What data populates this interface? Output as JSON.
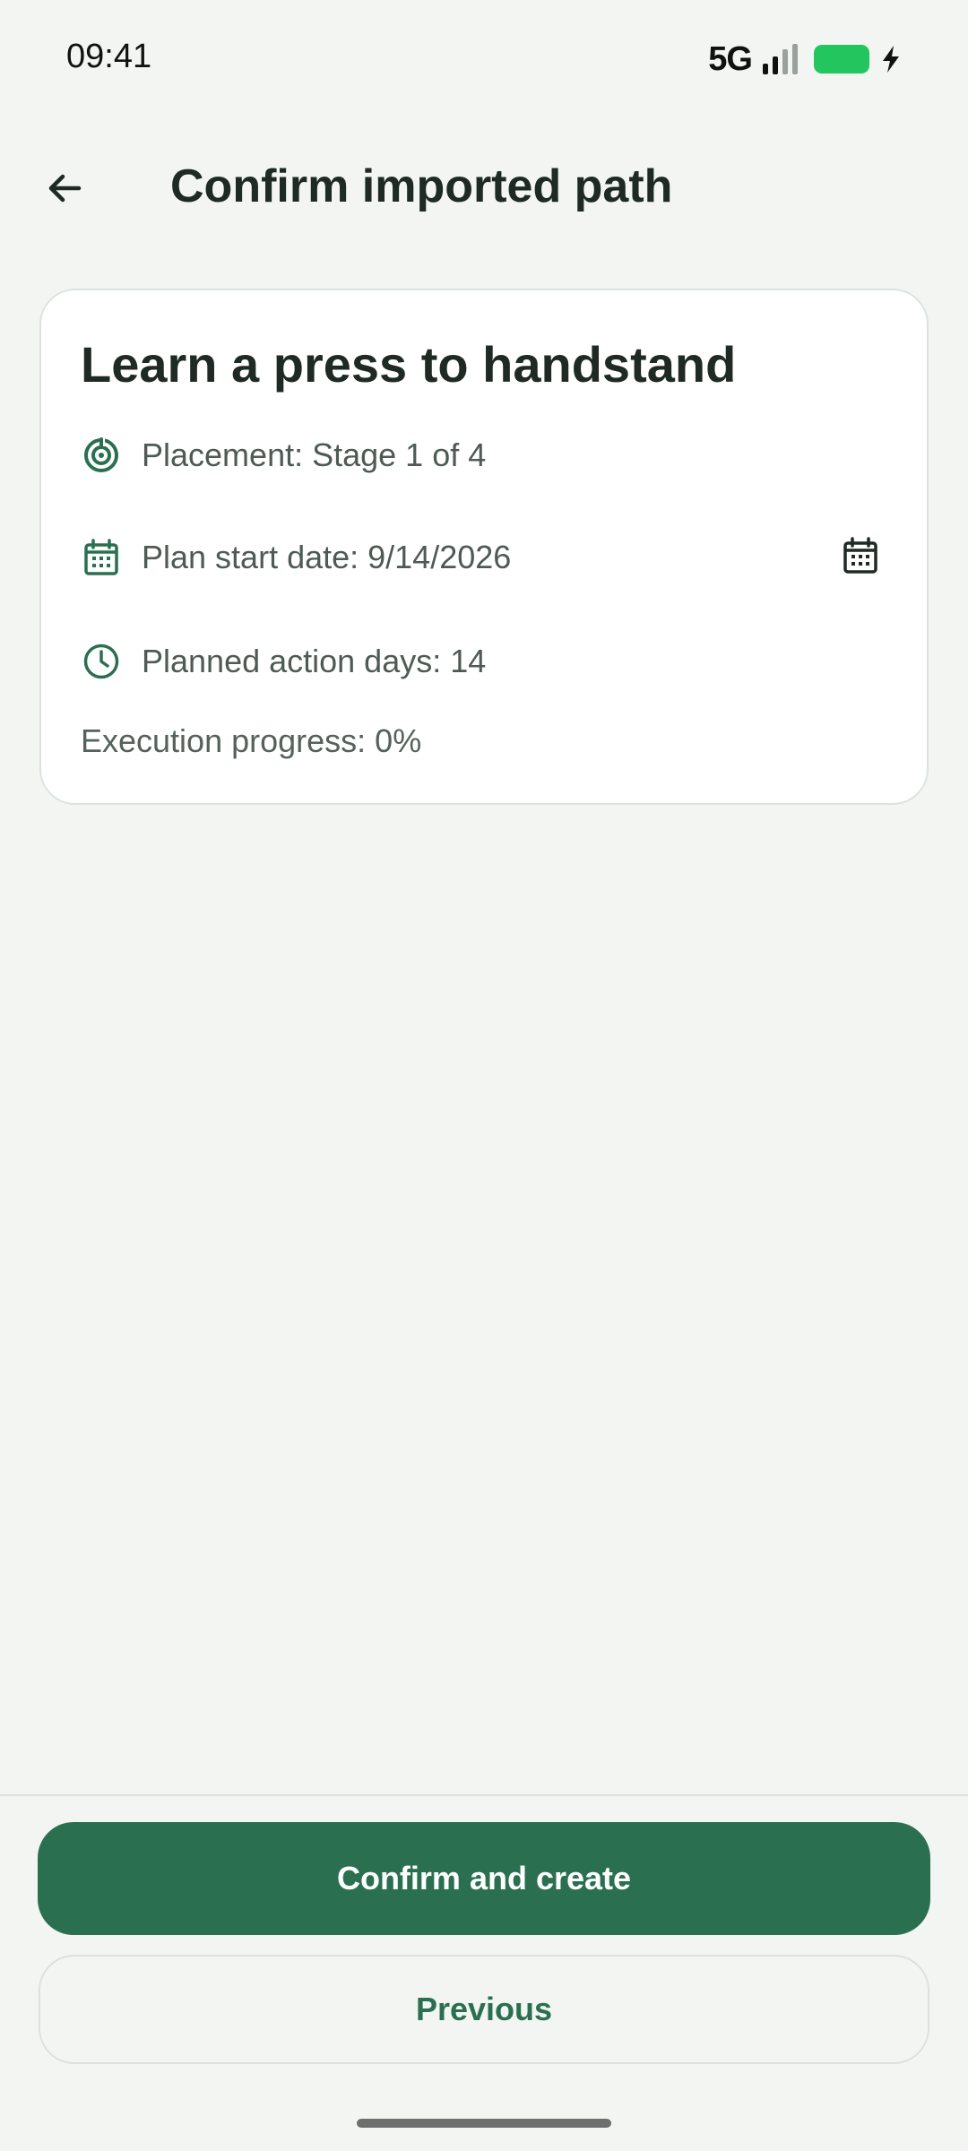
{
  "status_bar": {
    "time": "09:41",
    "network": "5G",
    "icons": [
      "signal-icon",
      "battery-icon",
      "charging-bolt-icon"
    ]
  },
  "header": {
    "back_icon": "arrow-left-icon",
    "title": "Confirm imported path"
  },
  "card": {
    "title": "Learn a press to handstand",
    "placement": "Placement: Stage 1 of 4",
    "start_date": "Plan start date: 9/14/2026",
    "action_days": "Planned action days: 14",
    "progress": "Execution progress: 0%",
    "icons": {
      "placement": "target-icon",
      "start_date": "calendar-icon",
      "date_picker": "calendar-picker-icon",
      "action_days": "clock-icon"
    }
  },
  "actions": {
    "confirm_label": "Confirm and create",
    "previous_label": "Previous"
  },
  "colors": {
    "background": "#F3F5F2",
    "accent": "#2A7050",
    "card": "#FFFFFF",
    "text_primary": "#1F2A24",
    "text_secondary": "#4E5A54"
  }
}
